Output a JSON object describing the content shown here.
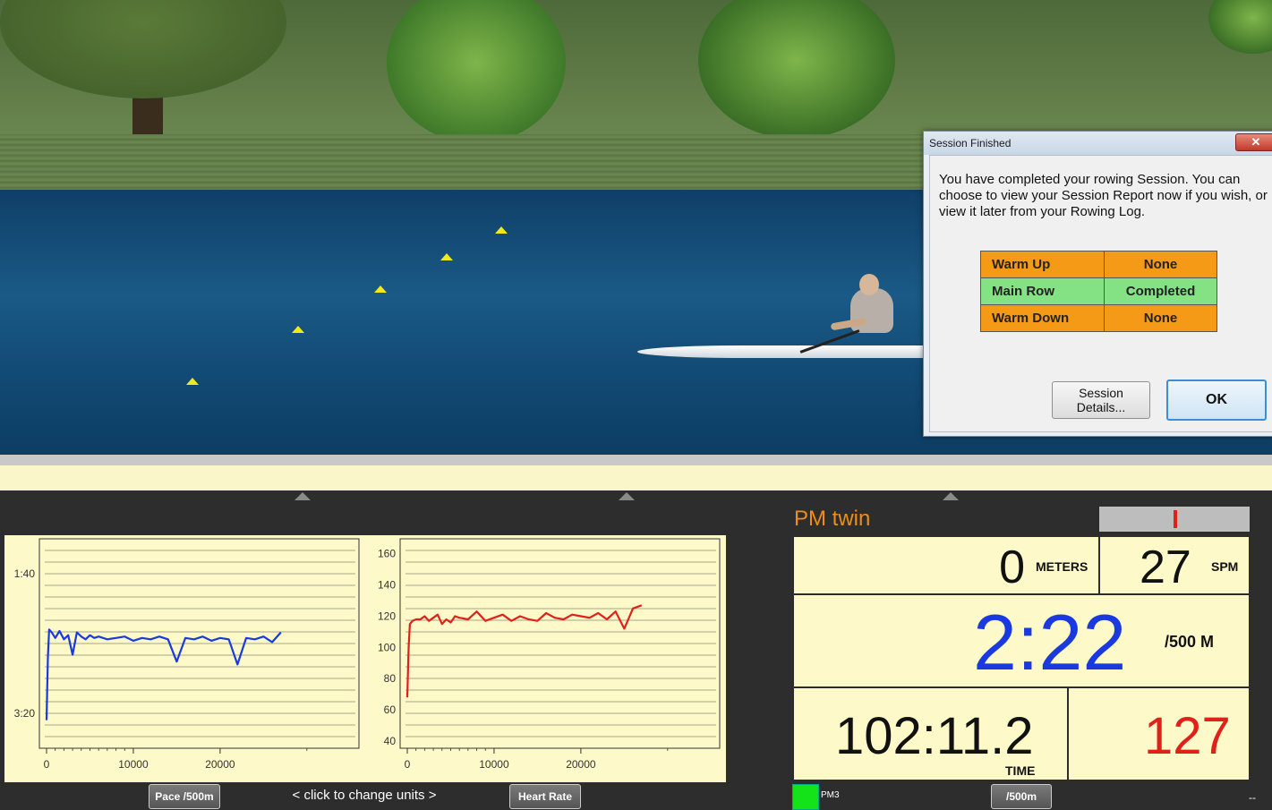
{
  "dialog": {
    "title": "Session Finished",
    "close_label": "✕",
    "message": "You have completed your rowing Session.  You can choose to view your Session Report now if you wish, or view it later from your Rowing Log.",
    "rows": [
      {
        "phase": "Warm Up",
        "status": "None",
        "color": "#f59a16"
      },
      {
        "phase": "Main Row",
        "status": "Completed",
        "color": "#84e284"
      },
      {
        "phase": "Warm Down",
        "status": "None",
        "color": "#f59a16"
      }
    ],
    "details_button": "Session Details...",
    "ok_button": "OK"
  },
  "graphs": {
    "pace_button": "Pace /500m",
    "hint": "<  click to change units  >",
    "hr_button": "Heart Rate"
  },
  "chart_data": [
    {
      "type": "line",
      "title": "",
      "xlabel": "",
      "ylabel": "",
      "x_ticks": [
        "0",
        "10000",
        "20000"
      ],
      "xlim": [
        0,
        36000
      ],
      "y_ticks": [
        "1:40",
        "3:20"
      ],
      "ylim_seconds": [
        220,
        80
      ],
      "y_reversed": true,
      "grid": true,
      "series": [
        {
          "color": "#1a3adf",
          "x": [
            0,
            150,
            300,
            600,
            1000,
            1500,
            2000,
            2500,
            3000,
            3500,
            4000,
            4500,
            5000,
            5500,
            6000,
            7000,
            8000,
            9000,
            10000,
            11000,
            12000,
            13000,
            14000,
            15000,
            16000,
            17000,
            18000,
            19000,
            20000,
            21000,
            22000,
            23000,
            24000,
            25000,
            26000,
            27000
          ],
          "y": [
            205,
            160,
            140,
            142,
            146,
            141,
            147,
            144,
            158,
            142,
            145,
            147,
            144,
            146,
            145,
            147,
            146,
            145,
            148,
            146,
            147,
            145,
            147,
            163,
            146,
            147,
            145,
            148,
            146,
            147,
            165,
            146,
            147,
            145,
            149,
            142
          ]
        }
      ]
    },
    {
      "type": "line",
      "title": "",
      "xlabel": "",
      "ylabel": "",
      "x_ticks": [
        "0",
        "10000",
        "20000"
      ],
      "xlim": [
        0,
        36000
      ],
      "y_ticks": [
        "160",
        "140",
        "120",
        "100",
        "80",
        "60",
        "40"
      ],
      "ylim": [
        40,
        165
      ],
      "grid": true,
      "series": [
        {
          "color": "#e0211a",
          "x": [
            0,
            150,
            300,
            600,
            1000,
            1500,
            2000,
            2500,
            3000,
            3500,
            4000,
            4500,
            5000,
            5500,
            6000,
            7000,
            8000,
            9000,
            10000,
            11000,
            12000,
            13000,
            14000,
            15000,
            16000,
            17000,
            18000,
            19000,
            20000,
            21000,
            22000,
            23000,
            24000,
            25000,
            26000,
            27000
          ],
          "y": [
            68,
            100,
            115,
            117,
            118,
            118,
            120,
            117,
            119,
            121,
            115,
            118,
            116,
            120,
            119,
            118,
            123,
            117,
            119,
            121,
            117,
            120,
            118,
            117,
            122,
            119,
            118,
            121,
            120,
            119,
            122,
            118,
            123,
            112,
            125,
            127
          ]
        }
      ]
    }
  ],
  "pm": {
    "title": "PM twin",
    "meters_value": "0",
    "meters_unit": "METERS",
    "spm_value": "27",
    "spm_unit": "SPM",
    "pace_value": "2:22",
    "pace_unit": "/500 M",
    "time_value": "102:11.2",
    "time_unit": "TIME",
    "hr_value": "127",
    "pace_color": "#1a3adf",
    "hr_color": "#e0211a",
    "led_label": "PM3",
    "units_button": "/500m",
    "corner_text": "--"
  }
}
